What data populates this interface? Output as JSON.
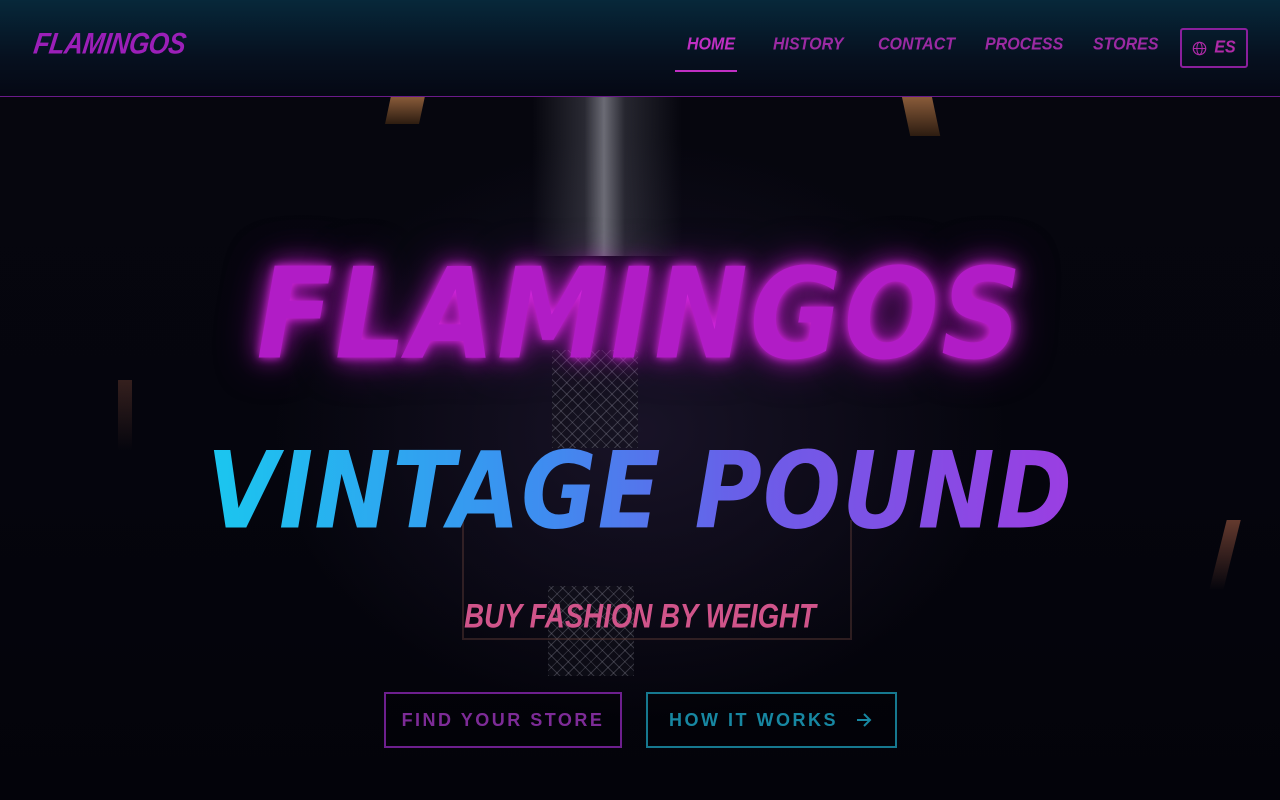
{
  "brand": {
    "name": "FLAMINGOS"
  },
  "nav": {
    "items": [
      {
        "label": "HOME",
        "active": true
      },
      {
        "label": "HISTORY",
        "active": false
      },
      {
        "label": "CONTACT",
        "active": false
      },
      {
        "label": "PROCESS",
        "active": false
      },
      {
        "label": "STORES",
        "active": false
      }
    ],
    "language": {
      "label": "ES",
      "icon": "globe-icon"
    }
  },
  "hero": {
    "title": "FLAMINGOS",
    "subtitle": "VINTAGE POUND",
    "tagline": "BUY FASHION BY WEIGHT",
    "buttons": {
      "find_store": "FIND YOUR STORE",
      "how_it_works": "HOW IT WORKS",
      "how_it_works_icon": "arrow-right-icon"
    }
  },
  "colors": {
    "brand_magenta": "#b11cc6",
    "cyan_accent": "#1ac7ef",
    "violet_accent": "#9b3ee2",
    "tagline_pink": "#d0548a",
    "header_bg": "#07283a"
  }
}
